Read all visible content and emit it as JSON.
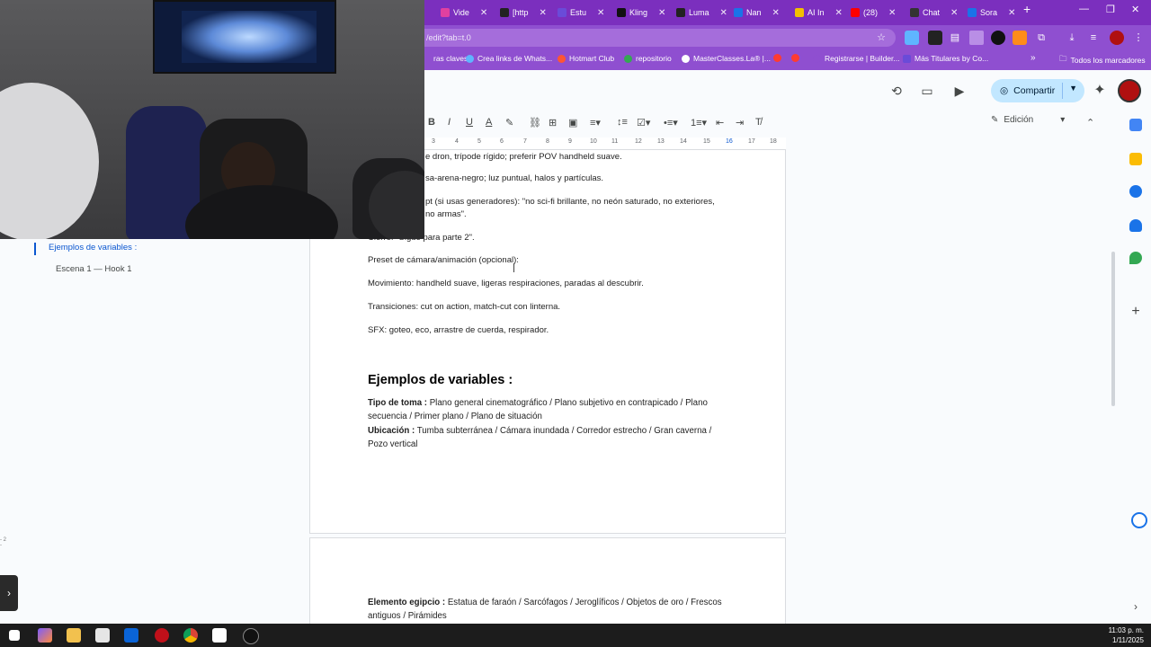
{
  "browser": {
    "tabs": [
      {
        "label": "Vide",
        "color": "#e040a0"
      },
      {
        "label": "[http",
        "color": "#222222"
      },
      {
        "label": "Estu",
        "color": "#6a4bd8"
      },
      {
        "label": "Kling",
        "color": "#111111"
      },
      {
        "label": "Luma",
        "color": "#222222"
      },
      {
        "label": "Nan",
        "color": "#1a73e8"
      },
      {
        "label": "AI In",
        "color": "#f2c000"
      },
      {
        "label": "(28)",
        "color": "#ff0000"
      },
      {
        "label": "Chat",
        "color": "#333333"
      },
      {
        "label": "Sora",
        "color": "#1a73e8"
      }
    ],
    "url": "/edit?tab=t.0",
    "bookmarks": [
      {
        "label": "ras claves",
        "color": "#8f4fd0"
      },
      {
        "label": "Crea links de Whats...",
        "color": "#5fb5ff"
      },
      {
        "label": "Hotmart Club",
        "color": "#ff5533"
      },
      {
        "label": "repositorio",
        "color": "#34a853"
      },
      {
        "label": "MasterClasses.La® |...",
        "color": "#ffffff"
      },
      {
        "label": "Registrarse | Builder...",
        "color": "#8f4fd0"
      },
      {
        "label": "Más Titulares by Co...",
        "color": "#6a4bd8"
      }
    ],
    "all_bookmarks": "Todos los marcadores"
  },
  "docs": {
    "share_label": "Compartir",
    "mode_label": "Edición",
    "ruler": [
      "3",
      "4",
      "5",
      "6",
      "7",
      "8",
      "9",
      "10",
      "11",
      "12",
      "13",
      "14",
      "15",
      "16",
      "17",
      "18"
    ]
  },
  "outline": {
    "heading": "Ejemplos de variables :",
    "subheading": "Escena 1 — Hook 1"
  },
  "document": {
    "line1": "e dron, trípode rígido; preferir POV handheld suave.",
    "line2": "sa-arena-negro; luz puntual, halos y partículas.",
    "line3a": "pt (si usas generadores): \"no sci-fi brillante, no neón saturado, no exteriores,",
    "line3b": "no armas\".",
    "line4": "Cierre: \"Sigue para parte 2\".",
    "line5": "Preset de cámara/animación (opcional):",
    "line6": "Movimiento: handheld suave, ligeras respiraciones, paradas al descubrir.",
    "line7": "Transiciones: cut on action, match-cut con linterna.",
    "line8": "SFX: goteo, eco, arrastre de cuerda, respirador.",
    "heading": "Ejemplos de variables :",
    "var1_label": "Tipo de toma :",
    "var1_text": " Plano general cinematográfico / Plano subjetivo en contrapicado / Plano secuencia / Primer plano / Plano de situación",
    "var2_label": "Ubicación :",
    "var2_text": " Tumba subterránea / Cámara inundada / Corredor estrecho / Gran caverna / Pozo vertical",
    "var3_label": "Elemento egipcio :",
    "var3_text": " Estatua de faraón / Sarcófagos / Jeroglíficos / Objetos de oro / Frescos antiguos / Pirámides"
  },
  "taskbar": {
    "time": "11:03 p. m.",
    "date": "1/11/2025"
  },
  "colors": {
    "browser_purple": "#7b2fbe",
    "share_bg": "#c2e7ff",
    "accent_blue": "#0b57d0"
  }
}
